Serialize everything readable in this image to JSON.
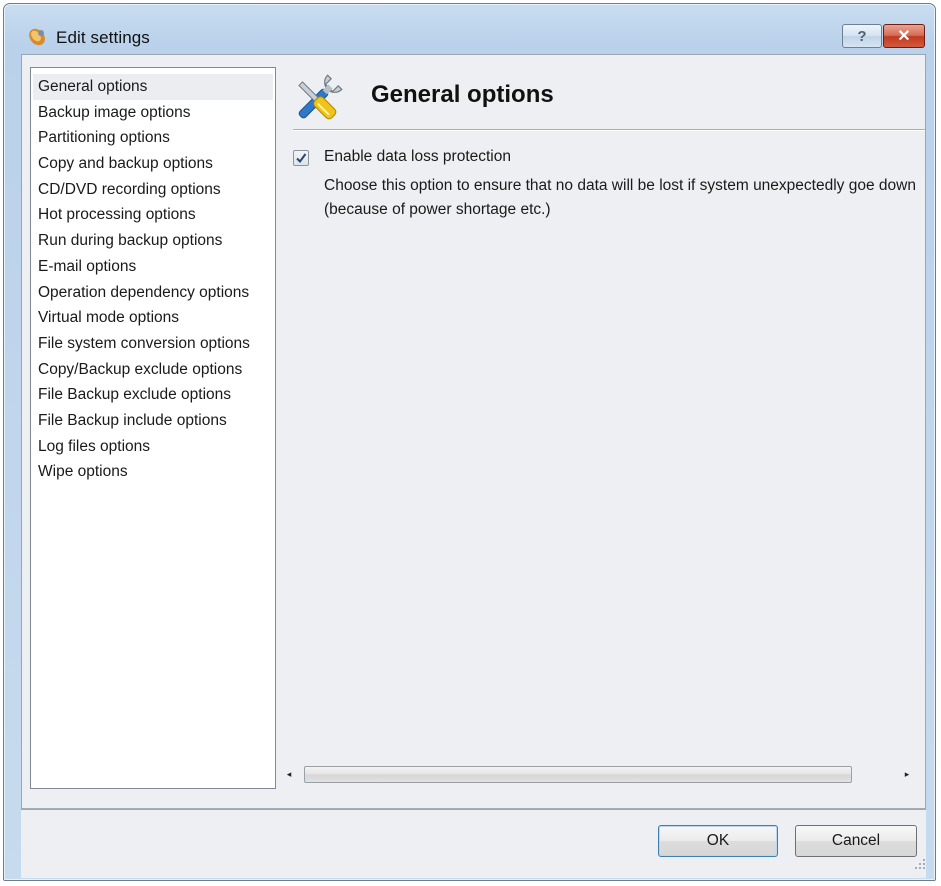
{
  "window": {
    "title": "Edit settings",
    "help_label": "?",
    "close_label": "✕"
  },
  "sidebar": {
    "items": [
      {
        "label": "General options",
        "selected": true
      },
      {
        "label": "Backup image options"
      },
      {
        "label": "Partitioning options"
      },
      {
        "label": "Copy and backup options"
      },
      {
        "label": "CD/DVD recording options"
      },
      {
        "label": "Hot processing options"
      },
      {
        "label": "Run during backup options"
      },
      {
        "label": "E-mail options"
      },
      {
        "label": "Operation dependency options"
      },
      {
        "label": "Virtual mode options"
      },
      {
        "label": "File system conversion options"
      },
      {
        "label": "Copy/Backup exclude options"
      },
      {
        "label": "File Backup exclude options"
      },
      {
        "label": "File Backup include options"
      },
      {
        "label": "Log files options"
      },
      {
        "label": "Wipe options"
      }
    ]
  },
  "main": {
    "header_icon": "tools-icon",
    "title": "General options",
    "option": {
      "label": "Enable data loss protection",
      "checked": true,
      "description": "Choose this option to ensure that no data will be lost if system unexpectedly goe down (because of power shortage etc.)"
    }
  },
  "scrollbar": {
    "left_arrow": "◂",
    "right_arrow": "▸"
  },
  "footer": {
    "ok_label": "OK",
    "cancel_label": "Cancel"
  }
}
